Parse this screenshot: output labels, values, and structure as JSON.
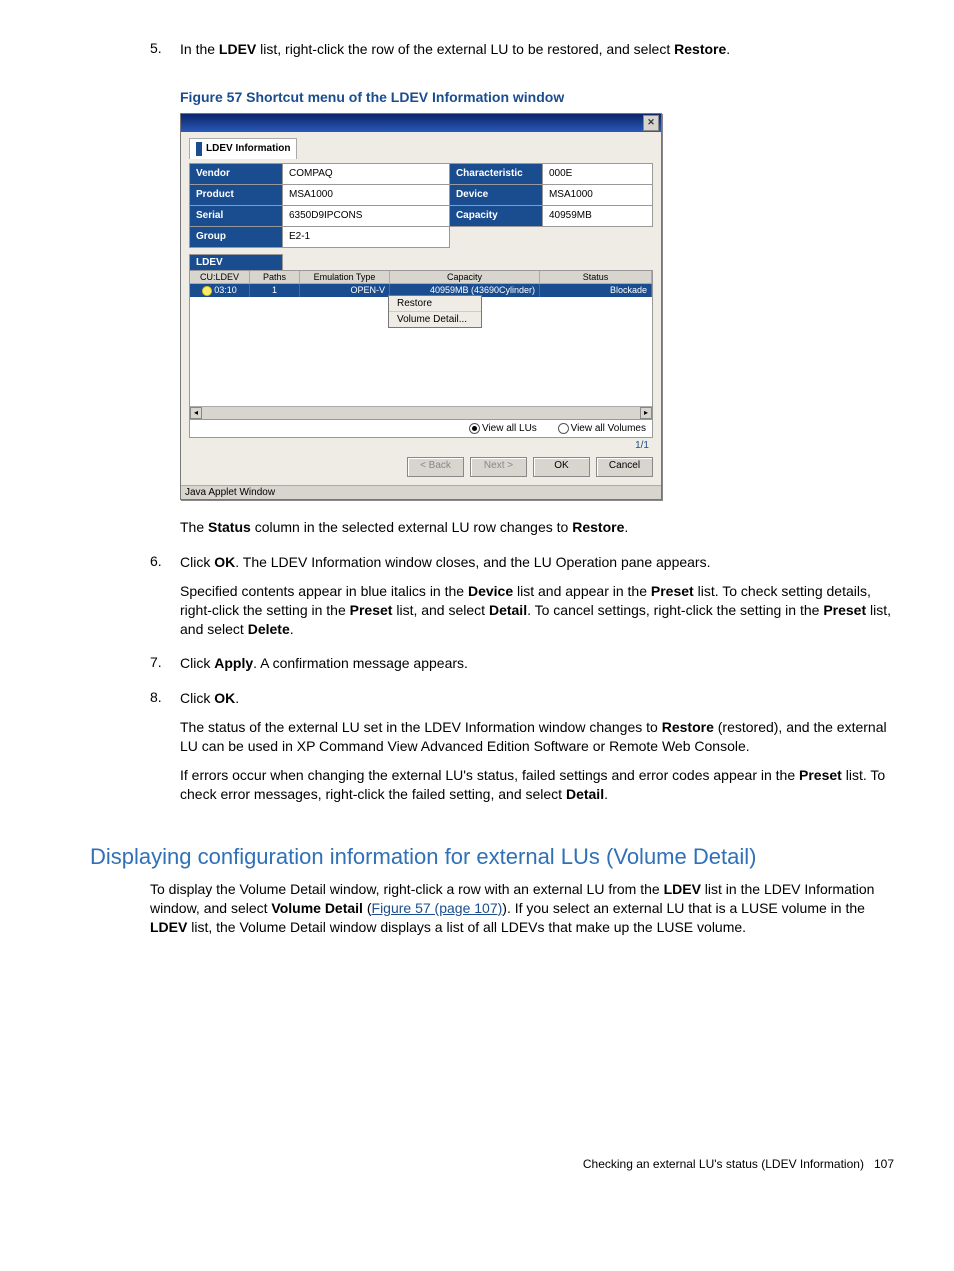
{
  "steps": {
    "s5": {
      "num": "5.",
      "text_pre": "In the ",
      "bold1": "LDEV",
      "text_mid": " list, right-click the row of the external LU to be restored, and select ",
      "bold2": "Restore",
      "text_post": "."
    },
    "s5_after": {
      "pre": "The ",
      "b1": "Status",
      "mid": " column in the selected external LU row changes to ",
      "b2": "Restore",
      "post": "."
    },
    "s6": {
      "num": "6.",
      "pre": "Click ",
      "b1": "OK",
      "post": ". The LDEV Information window closes, and the LU Operation pane appears.",
      "p2_1": "Specified contents appear in blue italics in the ",
      "p2_b1": "Device",
      "p2_2": " list and appear in the ",
      "p2_b2": "Preset",
      "p2_3": " list. To check setting details, right-click the setting in the ",
      "p2_b3": "Preset",
      "p2_4": " list, and select ",
      "p2_b4": "Detail",
      "p2_5": ". To cancel settings, right-click the setting in the ",
      "p2_b5": "Preset",
      "p2_6": " list, and select ",
      "p2_b6": "Delete",
      "p2_7": "."
    },
    "s7": {
      "num": "7.",
      "pre": "Click ",
      "b1": "Apply",
      "post": ". A confirmation message appears."
    },
    "s8": {
      "num": "8.",
      "pre": "Click ",
      "b1": "OK",
      "post": ".",
      "p2_1": "The status of the external LU set in the LDEV Information window changes to ",
      "p2_b1": "Restore",
      "p2_2": " (restored), and the external LU can be used in XP Command View Advanced Edition Software or Remote Web Console.",
      "p3_1": "If errors occur when changing the external LU's status, failed settings and error codes appear in the ",
      "p3_b1": "Preset",
      "p3_2": " list. To check error messages, right-click the failed setting, and select ",
      "p3_b2": "Detail",
      "p3_3": "."
    }
  },
  "figure": {
    "caption": "Figure 57 Shortcut menu of the LDEV Information window"
  },
  "window": {
    "tabTitle": "LDEV Information",
    "info": {
      "vendor_h": "Vendor",
      "vendor_v": "COMPAQ",
      "product_h": "Product",
      "product_v": "MSA1000",
      "serial_h": "Serial",
      "serial_v": "6350D9IPCONS",
      "group_h": "Group",
      "group_v": "E2-1",
      "char_h": "Characteristic",
      "char_v": "000E",
      "device_h": "Device",
      "device_v": "MSA1000",
      "capacity_h": "Capacity",
      "capacity_v": "40959MB"
    },
    "ldevLabel": "LDEV",
    "cols": {
      "c1": "CU:LDEV",
      "c2": "Paths",
      "c3": "Emulation Type",
      "c4": "Capacity",
      "c5": "Status"
    },
    "row": {
      "c1": "03:10",
      "c2": "1",
      "c3": "OPEN-V",
      "c4": "40959MB (43690Cylinder)",
      "c5": "Blockade"
    },
    "ctx": {
      "restore": "Restore",
      "volDetail": "Volume Detail..."
    },
    "radios": {
      "lus": "View all LUs",
      "vols": "View all Volumes"
    },
    "pageLabel": "1/1",
    "buttons": {
      "back": "< Back",
      "next": "Next >",
      "ok": "OK",
      "cancel": "Cancel"
    },
    "statusBar": "Java Applet Window"
  },
  "section": {
    "title": "Displaying configuration information for external LUs (Volume Detail)",
    "p1_1": "To display the Volume Detail window, right-click a row with an external LU from the ",
    "p1_b1": "LDEV",
    "p1_2": " list in the LDEV Information window, and select ",
    "p1_b2": "Volume Detail",
    "p1_3": " (",
    "p1_link": "Figure 57 (page 107)",
    "p1_4": "). If you select an external LU that is a LUSE volume in the ",
    "p1_b3": "LDEV",
    "p1_5": " list, the Volume Detail window displays a list of all LDEVs that make up the LUSE volume."
  },
  "footer": {
    "text": "Checking an external LU's status (LDEV Information)",
    "page": "107"
  }
}
